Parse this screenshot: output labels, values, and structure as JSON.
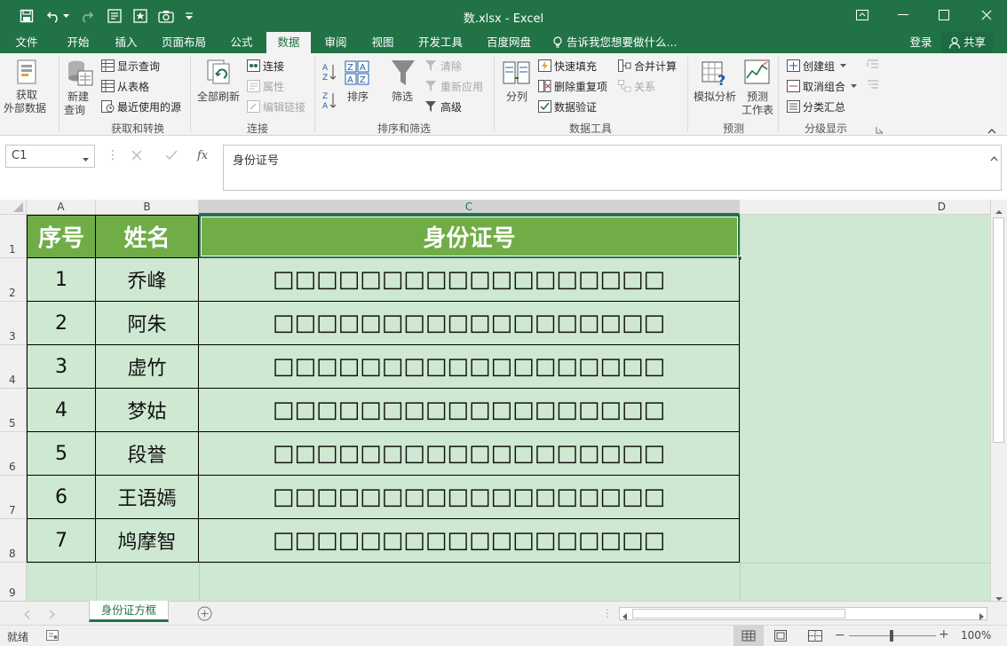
{
  "window": {
    "title": "数.xlsx - Excel"
  },
  "tabs": [
    "文件",
    "开始",
    "插入",
    "页面布局",
    "公式",
    "数据",
    "审阅",
    "视图",
    "开发工具",
    "百度网盘"
  ],
  "active_tab": "数据",
  "tell_me": "告诉我您想要做什么...",
  "account": {
    "login": "登录",
    "share": "共享"
  },
  "ribbon": {
    "get_transform": {
      "get_external_1": "获取",
      "get_external_2": "外部数据",
      "new_query_1": "新建",
      "new_query_2": "查询",
      "show_queries": "显示查询",
      "from_table": "从表格",
      "recent_sources": "最近使用的源",
      "group": "获取和转换"
    },
    "connections": {
      "refresh_all": "全部刷新",
      "connections": "连接",
      "properties": "属性",
      "edit_links": "编辑链接",
      "group": "连接"
    },
    "sort_filter": {
      "sort": "排序",
      "filter": "筛选",
      "clear": "清除",
      "reapply": "重新应用",
      "advanced": "高级",
      "group": "排序和筛选"
    },
    "data_tools": {
      "split": "分列",
      "flash_fill": "快速填充",
      "remove_dup": "删除重复项",
      "validation": "数据验证",
      "consolidate": "合并计算",
      "relations": "关系",
      "group": "数据工具"
    },
    "forecast": {
      "whatif": "模拟分析",
      "forecast_1": "预测",
      "forecast_2": "工作表",
      "group": "预测"
    },
    "outline": {
      "group_btn": "创建组",
      "ungroup": "取消组合",
      "subtotal": "分类汇总",
      "group": "分级显示"
    }
  },
  "formula_bar": {
    "name_box": "C1",
    "fx": "fx",
    "value": "身份证号"
  },
  "columns": [
    "A",
    "B",
    "C",
    "D"
  ],
  "rows": [
    "1",
    "2",
    "3",
    "4",
    "5",
    "6",
    "7",
    "8",
    "9"
  ],
  "table": {
    "headers": [
      "序号",
      "姓名",
      "身份证号"
    ],
    "rows": [
      [
        "1",
        "乔峰",
        "□□□□□□□□□□□□□□□□□□"
      ],
      [
        "2",
        "阿朱",
        "□□□□□□□□□□□□□□□□□□"
      ],
      [
        "3",
        "虚竹",
        "□□□□□□□□□□□□□□□□□□"
      ],
      [
        "4",
        "梦姑",
        "□□□□□□□□□□□□□□□□□□"
      ],
      [
        "5",
        "段誉",
        "□□□□□□□□□□□□□□□□□□"
      ],
      [
        "6",
        "王语嫣",
        "□□□□□□□□□□□□□□□□□□"
      ],
      [
        "7",
        "鸠摩智",
        "□□□□□□□□□□□□□□□□□□"
      ]
    ]
  },
  "sheet_tab": "身份证方框",
  "status": {
    "ready": "就绪",
    "zoom": "100%"
  },
  "colors": {
    "excel_green": "#217346",
    "header_green": "#70ad47",
    "cell_green": "#cfe8d1"
  }
}
